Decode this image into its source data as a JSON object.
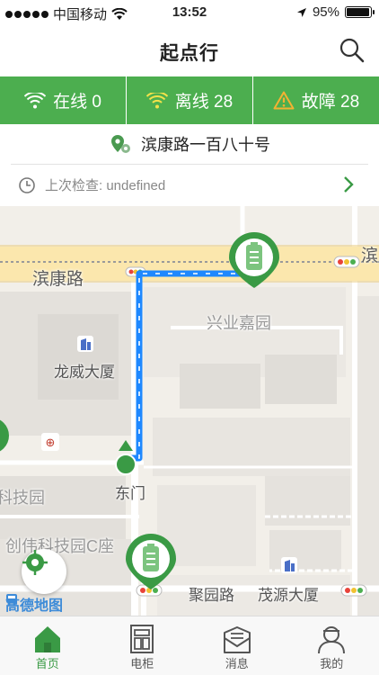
{
  "status_bar": {
    "carrier": "中国移动",
    "time": "13:52",
    "battery_percent": "95%",
    "battery_level": 0.95
  },
  "nav": {
    "title": "起点行",
    "search_icon": "search-icon"
  },
  "status_strip": {
    "online_label": "在线 0",
    "offline_label": "离线 28",
    "fault_label": "故障 28",
    "colors": {
      "background": "#4cae4f",
      "offline_icon": "#f3e24a",
      "fault_icon": "#f3b232"
    }
  },
  "location": {
    "address": "滨康路一百八十号",
    "last_check": "上次检查: undefined"
  },
  "map": {
    "labels": {
      "road_binkang": "滨康路",
      "road_binkang_edge": "滨",
      "xingye": "兴业嘉园",
      "longwei": "龙威大厦",
      "keji": "科技园",
      "dongmen": "东门",
      "chuangwei": "创伟科技园C座",
      "juyuan": "聚园路",
      "maoyuan": "茂源大厦"
    },
    "logo": "高德地图",
    "route_color": "#1e88ff",
    "marker_color": "#3a9a45"
  },
  "tabs": [
    {
      "label": "首页",
      "icon": "home-icon",
      "active": true
    },
    {
      "label": "电柜",
      "icon": "cabinet-icon",
      "active": false
    },
    {
      "label": "消息",
      "icon": "message-icon",
      "active": false
    },
    {
      "label": "我的",
      "icon": "profile-icon",
      "active": false
    }
  ]
}
